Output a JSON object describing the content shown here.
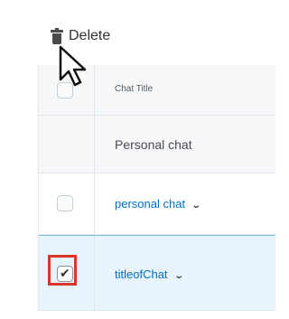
{
  "toolbar": {
    "delete_label": "Delete"
  },
  "table": {
    "header": {
      "chat_title": "Chat Title"
    },
    "rows": [
      {
        "title": "Personal chat",
        "has_checkbox": false,
        "checked": false
      },
      {
        "title": "personal chat",
        "has_checkbox": true,
        "checked": false,
        "chevron": "⌄"
      },
      {
        "title": "titleofChat",
        "has_checkbox": true,
        "checked": true,
        "chevron": "⌄"
      }
    ]
  },
  "icons": {
    "delete": "trash-icon",
    "cursor": "mouse-pointer-icon",
    "check": "checkmark-icon",
    "chevron": "chevron-down-icon"
  },
  "colors": {
    "link": "#006fbf",
    "selected_row": "#e8f4fb",
    "highlight_box": "#d9352b"
  },
  "glyphs": {
    "check": "✔"
  }
}
